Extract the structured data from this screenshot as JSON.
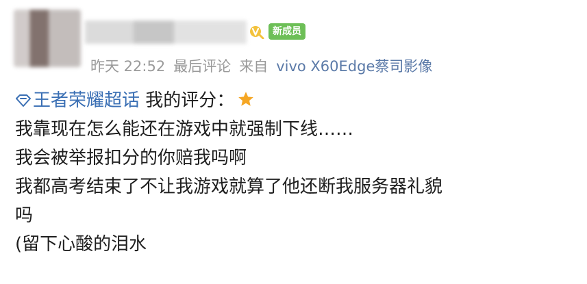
{
  "header": {
    "badge_label": "新成员"
  },
  "meta": {
    "time": "昨天 22:52",
    "action": "最后评论",
    "source_prefix": "来自",
    "device": "vivo X60Edge蔡司影像"
  },
  "post": {
    "topic": "王者荣耀超话",
    "rating_label": "我的评分：",
    "rating_icon": "star-icon",
    "lines": [
      "我靠现在怎么能还在游戏中就强制下线……",
      "我会被举报扣分的你赔我吗啊",
      "我都高考结束了不让我游戏就算了他还断我服务器礼貌",
      "吗",
      "(留下心酸的泪水"
    ]
  },
  "colors": {
    "badge": "#6dbf57",
    "topic": "#3a6fb4",
    "meta": "#9a9a9a",
    "star": "#f5a623"
  }
}
